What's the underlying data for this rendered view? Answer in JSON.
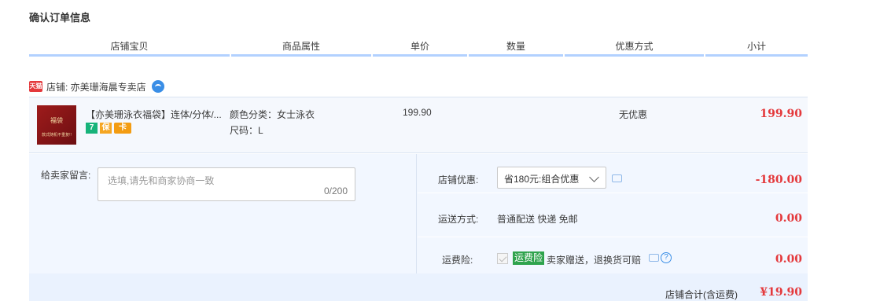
{
  "page": {
    "title": "确认订单信息"
  },
  "columns": [
    "店铺宝贝",
    "商品属性",
    "单价",
    "数量",
    "优惠方式",
    "小计"
  ],
  "shop": {
    "badge": "天猫",
    "label": "店铺: 亦美珊海晨专卖店",
    "icon": "wangwang-chat-icon"
  },
  "item": {
    "thumb_text": "福袋",
    "thumb_subtext": "款式随机不重复!!",
    "name": "【亦美珊泳衣福袋】连体/分体/...",
    "service_icons": [
      "7",
      "保",
      "卡"
    ],
    "attr_color": "颜色分类：女士泳衣",
    "attr_size": "尺码：L",
    "price": "199.90",
    "discount": "无优惠",
    "subtotal": "199.90"
  },
  "message": {
    "label": "给卖家留言:",
    "placeholder": "选填,请先和商家协商一致",
    "counter": "0/200"
  },
  "options": {
    "shop_discount_label": "店铺优惠:",
    "shop_discount_value": "省180元:组合优惠",
    "shop_discount_amount": "-180.00",
    "shipping_label": "运送方式:",
    "shipping_value": "普通配送 快递 免邮",
    "shipping_amount": "0.00",
    "insurance_label": "运费险:",
    "insurance_badge": "运费险",
    "insurance_text": "卖家赠送，退换货可赔",
    "insurance_amount": "0.00"
  },
  "total": {
    "label": "店铺合计(含运费)",
    "value": "¥19.90"
  },
  "colors": {
    "accent_red": "#e4393c",
    "header_line": "#b2d1ff",
    "panel_bg": "#f2f7ff"
  }
}
